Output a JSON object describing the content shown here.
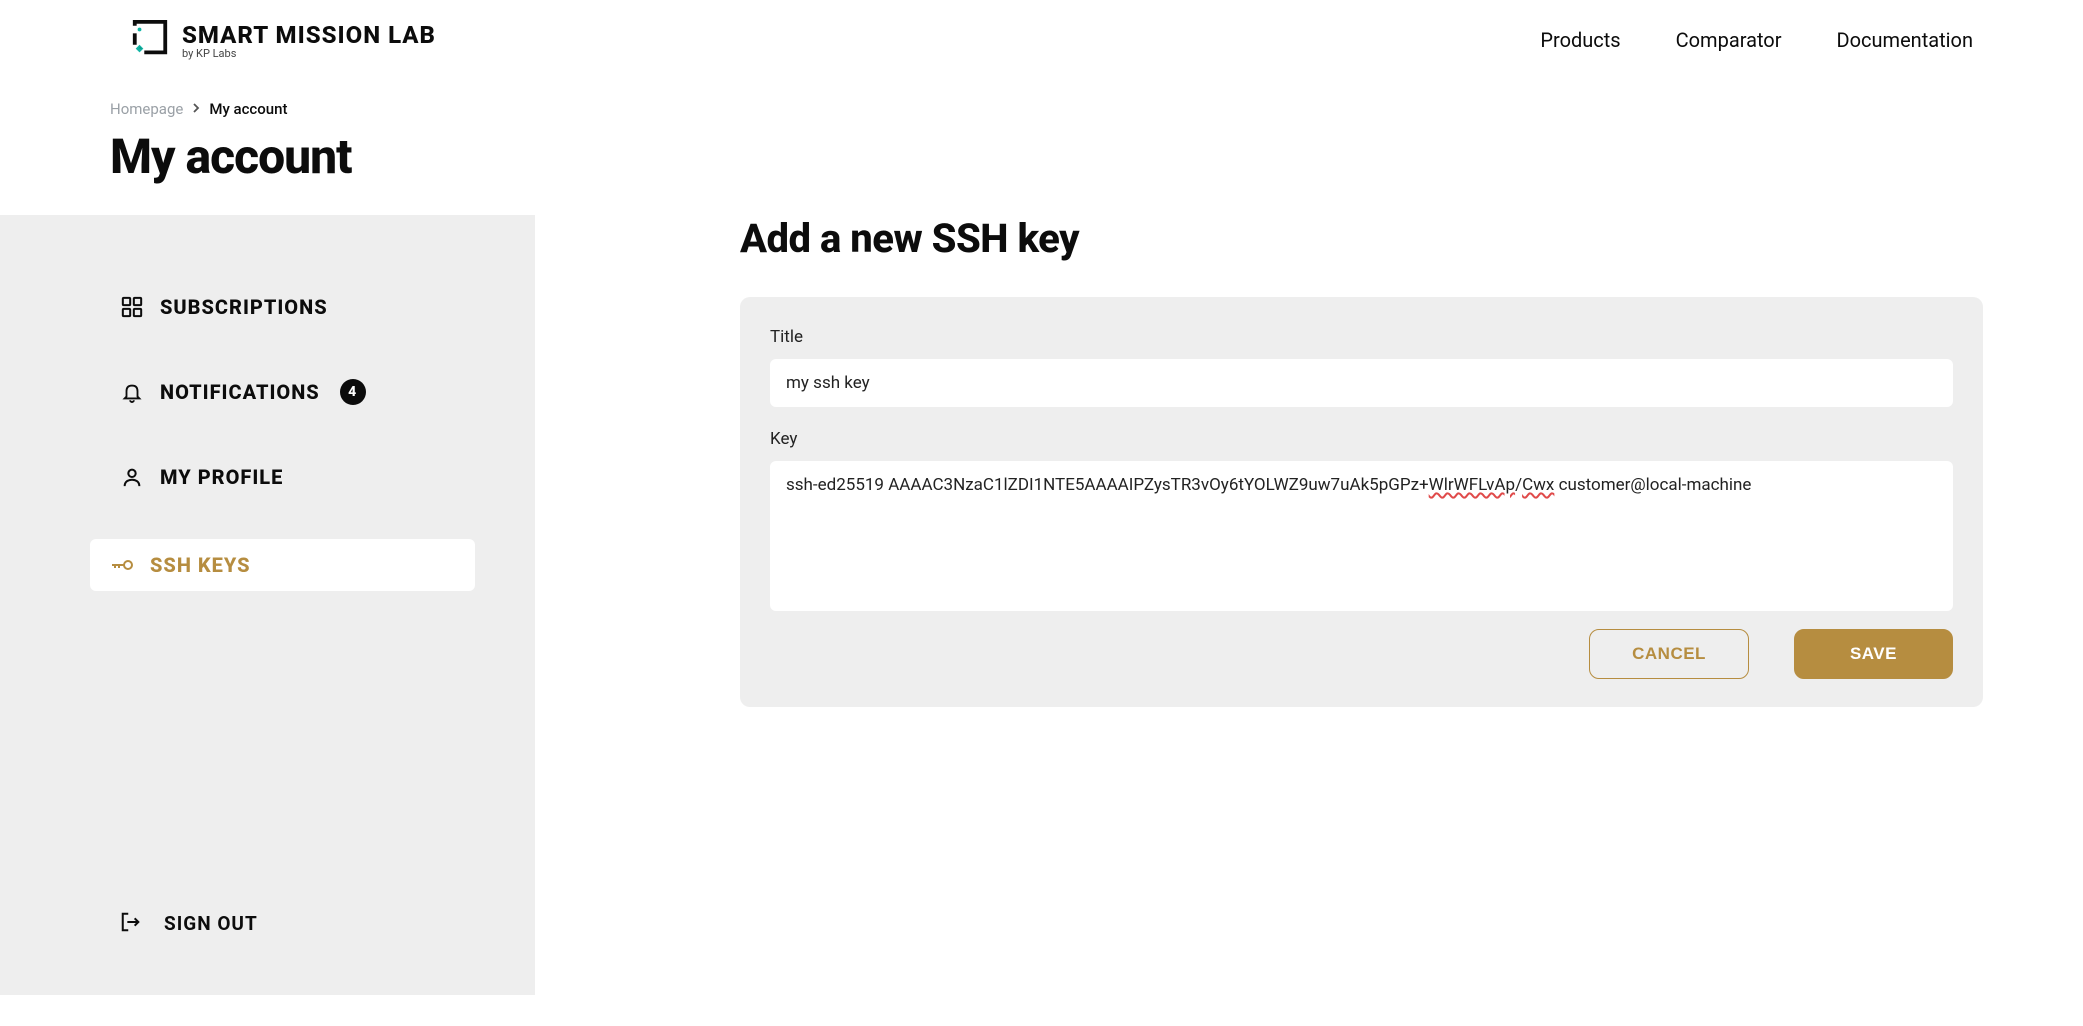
{
  "brand": {
    "title": "SMART MISSION LAB",
    "subtitle": "by KP Labs"
  },
  "nav": {
    "products": "Products",
    "comparator": "Comparator",
    "documentation": "Documentation"
  },
  "breadcrumb": {
    "home": "Homepage",
    "current": "My account"
  },
  "page_title": "My account",
  "sidebar": {
    "subscriptions": "SUBSCRIPTIONS",
    "notifications": "NOTIFICATIONS",
    "notifications_badge": "4",
    "my_profile": "MY PROFILE",
    "ssh_keys": "SSH KEYS",
    "sign_out": "SIGN OUT"
  },
  "content": {
    "heading": "Add a new SSH key",
    "form": {
      "title_label": "Title",
      "title_value": "my ssh key",
      "key_label": "Key",
      "key_value": "ssh-ed25519 AAAAC3NzaC1lZDI1NTE5AAAAIPZysTR3vOy6tYOLWZ9uw7uAk5pGPz+WlrWFLvAp/Cwx customer@local-machine",
      "key_prefix": "ssh-ed25519 AAAAC3NzaC1lZDI1NTE5AAAAIPZysTR3vOy6tYOLWZ9uw7uAk5pGPz+",
      "key_spell": "WlrWFLvAp",
      "key_mid": "/",
      "key_spell2": "Cwx",
      "key_suffix": " customer@local-machine",
      "cancel": "CANCEL",
      "save": "SAVE"
    }
  }
}
